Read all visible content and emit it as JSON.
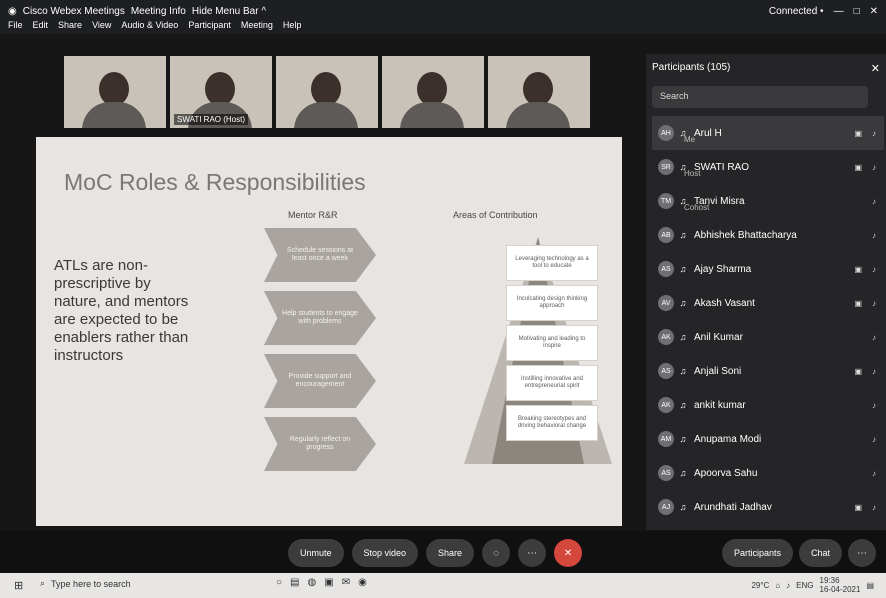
{
  "window": {
    "title": "Cisco Webex Meetings",
    "meeting_info": "Meeting Info",
    "hide_menu_bar": "Hide Menu Bar ^",
    "connected": "Connected •",
    "menu": [
      "File",
      "Edit",
      "Share",
      "View",
      "Audio & Video",
      "Participant",
      "Meeting",
      "Help"
    ]
  },
  "videos": [
    {
      "name": ""
    },
    {
      "name": "SWATI RAO (Host)"
    },
    {
      "name": ""
    },
    {
      "name": ""
    },
    {
      "name": ""
    }
  ],
  "slide": {
    "title": "MoC Roles & Responsibilities",
    "body": "ATLs are non-prescriptive by nature, and mentors are expected to be enablers rather than instructors",
    "mentor_head": "Mentor R&R",
    "areas_head": "Areas of Contribution",
    "mentor_items": [
      "Schedule sessions at least once a week",
      "Help students to engage with problems",
      "Provide support and encouragement",
      "Regularly reflect on progress"
    ],
    "areas": [
      "Leveraging technology as a tool to educate",
      "Inculcating design thinking approach",
      "Motivating and leading to inspire",
      "Instilling innovative and entrepreneurial spirit",
      "Breaking stereotypes and driving behavioral change"
    ]
  },
  "participants": {
    "header": "Participants (105)",
    "search_placeholder": "Search",
    "items": [
      {
        "initials": "AH",
        "name": "Arul H",
        "role": "Me",
        "selected": true
      },
      {
        "initials": "SR",
        "name": "SWATI RAO",
        "role": "Host",
        "selected": false
      },
      {
        "initials": "TM",
        "name": "Tanvi Misra",
        "role": "Cohost",
        "selected": false
      },
      {
        "initials": "AB",
        "name": "Abhishek Bhattacharya",
        "role": "",
        "selected": false
      },
      {
        "initials": "AS",
        "name": "Ajay Sharma",
        "role": "",
        "selected": false
      },
      {
        "initials": "AV",
        "name": "Akash Vasant",
        "role": "",
        "selected": false
      },
      {
        "initials": "AK",
        "name": "Anil Kumar",
        "role": "",
        "selected": false
      },
      {
        "initials": "AS",
        "name": "Anjali Soni",
        "role": "",
        "selected": false
      },
      {
        "initials": "AK",
        "name": "ankit kumar",
        "role": "",
        "selected": false
      },
      {
        "initials": "AM",
        "name": "Anupama Modi",
        "role": "",
        "selected": false
      },
      {
        "initials": "AS",
        "name": "Apoorva Sahu",
        "role": "",
        "selected": false
      },
      {
        "initials": "AJ",
        "name": "Arundhati Jadhav",
        "role": "",
        "selected": false
      }
    ]
  },
  "controls": {
    "unmute": "Unmute",
    "stop_video": "Stop video",
    "share": "Share",
    "participants": "Participants",
    "chat": "Chat"
  },
  "taskbar": {
    "search": "Type here to search",
    "temp": "29°C",
    "lang": "ENG",
    "time": "19:36",
    "date": "16-04-2021"
  }
}
